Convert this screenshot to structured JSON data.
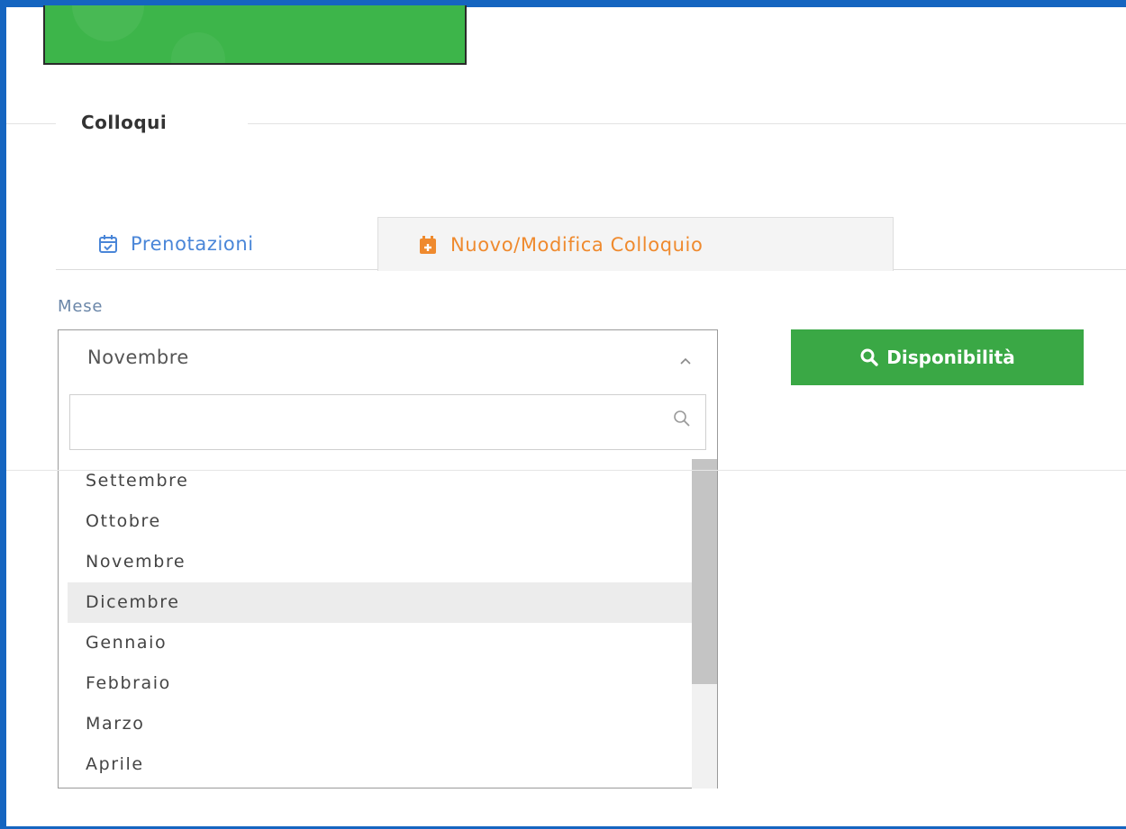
{
  "section": {
    "title": "Colloqui"
  },
  "tabs": [
    {
      "label": "Prenotazioni",
      "icon": "calendar-check-icon",
      "color": "#4a86d8",
      "active": false
    },
    {
      "label": "Nuovo/Modifica Colloquio",
      "icon": "calendar-plus-icon",
      "color": "#ef8a2e",
      "active": true
    }
  ],
  "month_select": {
    "label": "Mese",
    "selected": "Novembre",
    "search_value": "",
    "options": [
      "Settembre",
      "Ottobre",
      "Novembre",
      "Dicembre",
      "Gennaio",
      "Febbraio",
      "Marzo",
      "Aprile"
    ],
    "highlighted": "Dicembre"
  },
  "actions": {
    "availability_label": "Disponibilità"
  },
  "colors": {
    "accent_green": "#3aa845",
    "banner_green": "#3db54a",
    "frame_blue": "#1565c0"
  }
}
